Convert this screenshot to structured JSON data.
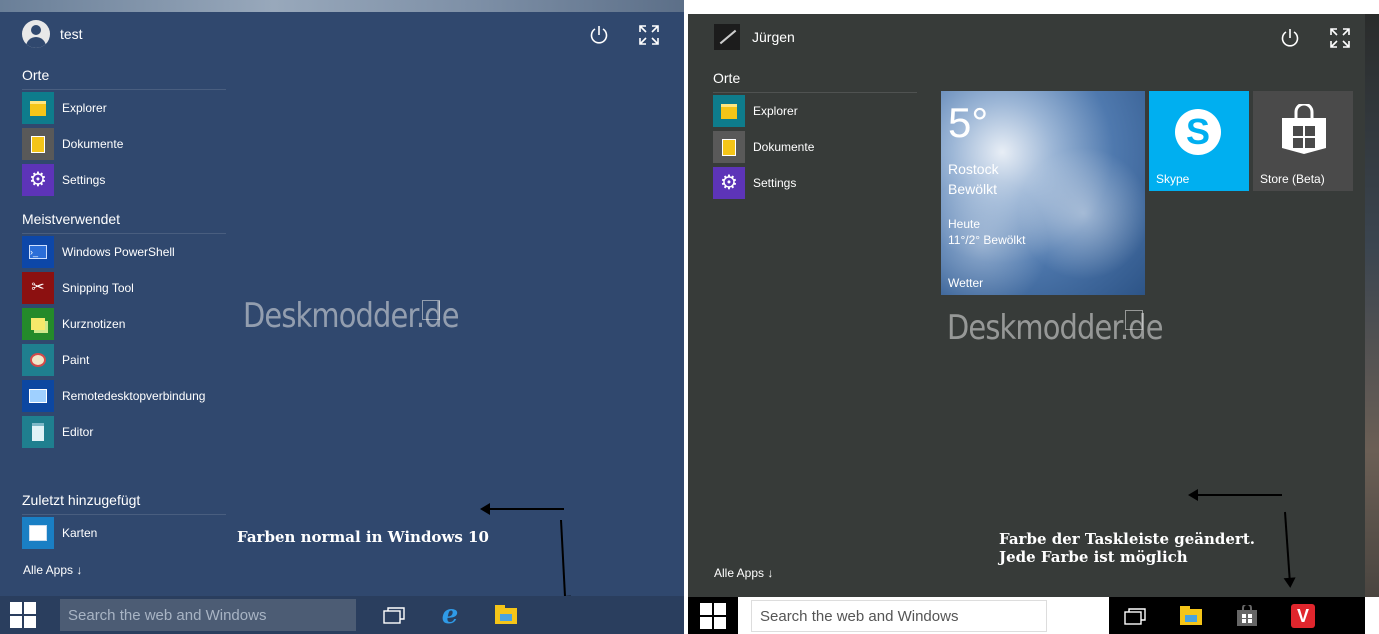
{
  "left": {
    "user_name": "test",
    "sections": {
      "places": "Orte",
      "most_used": "Meistverwendet",
      "recent": "Zuletzt hinzugefügt"
    },
    "places": [
      {
        "label": "Explorer",
        "icon": "explorer-icon",
        "color": "#0e7c8c"
      },
      {
        "label": "Dokumente",
        "icon": "documents-icon",
        "color": "#595959"
      },
      {
        "label": "Settings",
        "icon": "gear-icon",
        "color": "#5d34b8"
      }
    ],
    "most_used": [
      {
        "label": "Windows PowerShell",
        "icon": "powershell-icon",
        "color": "#0d47a8"
      },
      {
        "label": "Snipping Tool",
        "icon": "scissors-icon",
        "color": "#8c1010"
      },
      {
        "label": "Kurznotizen",
        "icon": "sticky-notes-icon",
        "color": "#248a2a"
      },
      {
        "label": "Paint",
        "icon": "paint-icon",
        "color": "#1f7f8f"
      },
      {
        "label": "Remotedesktopverbindung",
        "icon": "remote-desktop-icon",
        "color": "#0c47a1"
      },
      {
        "label": "Editor",
        "icon": "notepad-icon",
        "color": "#1f7f8f"
      }
    ],
    "recent": [
      {
        "label": "Karten",
        "icon": "maps-icon",
        "color": "#1a7fc4"
      }
    ],
    "all_apps": "Alle Apps ↓",
    "watermark": "Deskmodder.de",
    "caption": "Farben normal in Windows 10",
    "search_placeholder": "Search the web and Windows",
    "colors": {
      "menu": "#30486e",
      "taskbar": "#2a3e5e",
      "search": "#4c5c74"
    }
  },
  "right": {
    "user_name": "Jürgen",
    "sections": {
      "places": "Orte"
    },
    "places": [
      {
        "label": "Explorer",
        "icon": "explorer-icon",
        "color": "#0e7c8c"
      },
      {
        "label": "Dokumente",
        "icon": "documents-icon",
        "color": "#595959"
      },
      {
        "label": "Settings",
        "icon": "gear-icon",
        "color": "#5d34b8"
      }
    ],
    "all_apps": "Alle Apps ↓",
    "watermark": "Deskmodder.de",
    "caption_line1": "Farbe der Taskleiste geändert.",
    "caption_line2": "Jede Farbe ist möglich",
    "search_placeholder": "Search the web and Windows",
    "tiles": {
      "weather": {
        "temp": "5°",
        "city": "Rostock",
        "condition": "Bewölkt",
        "today_label": "Heute",
        "today_forecast": "11°/2° Bewölkt",
        "name": "Wetter"
      },
      "skype": {
        "name": "Skype",
        "color": "#00aff0"
      },
      "store": {
        "name": "Store (Beta)",
        "color": "#4a4a4a"
      }
    },
    "colors": {
      "menu": "#373b39",
      "taskbar": "#000000",
      "search": "#ffffff"
    }
  }
}
